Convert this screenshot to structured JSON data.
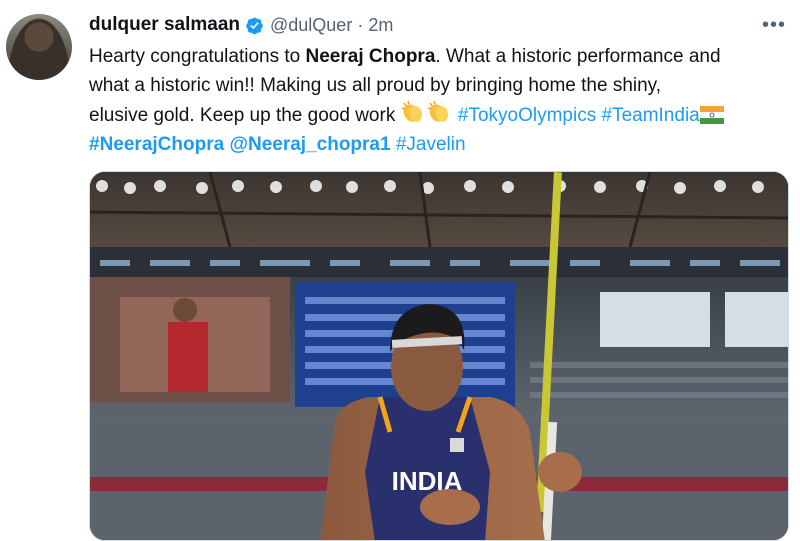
{
  "tweet": {
    "author_name": "dulquer salmaan",
    "handle": "@dulQuer",
    "separator": "·",
    "time": "2m",
    "more": "•••",
    "text": {
      "l1_a": "Hearty congratulations to ",
      "l1_b": "Neeraj Chopra",
      "l1_c": ". What a historic performance and",
      "l2": "what a historic win!! Making us all proud by bringing home the shiny,",
      "l3_a": "elusive gold. Keep up the good work ",
      "hashtag_tokyo": "#TokyoOlympics",
      "hashtag_team": "#TeamIndia",
      "hashtag_neeraj": "#NeerajChopra",
      "mention": "@Neeraj_chopra1",
      "hashtag_javelin": "#Javelin"
    },
    "media": {
      "jersey_text": "INDIA"
    }
  },
  "colors": {
    "link": "#1d9bf0",
    "verified": "#1d9bf0",
    "muted": "#536471"
  },
  "icons": [
    "verified-badge-icon",
    "more-options-icon",
    "clapping-hands-icon",
    "india-flag-icon"
  ]
}
